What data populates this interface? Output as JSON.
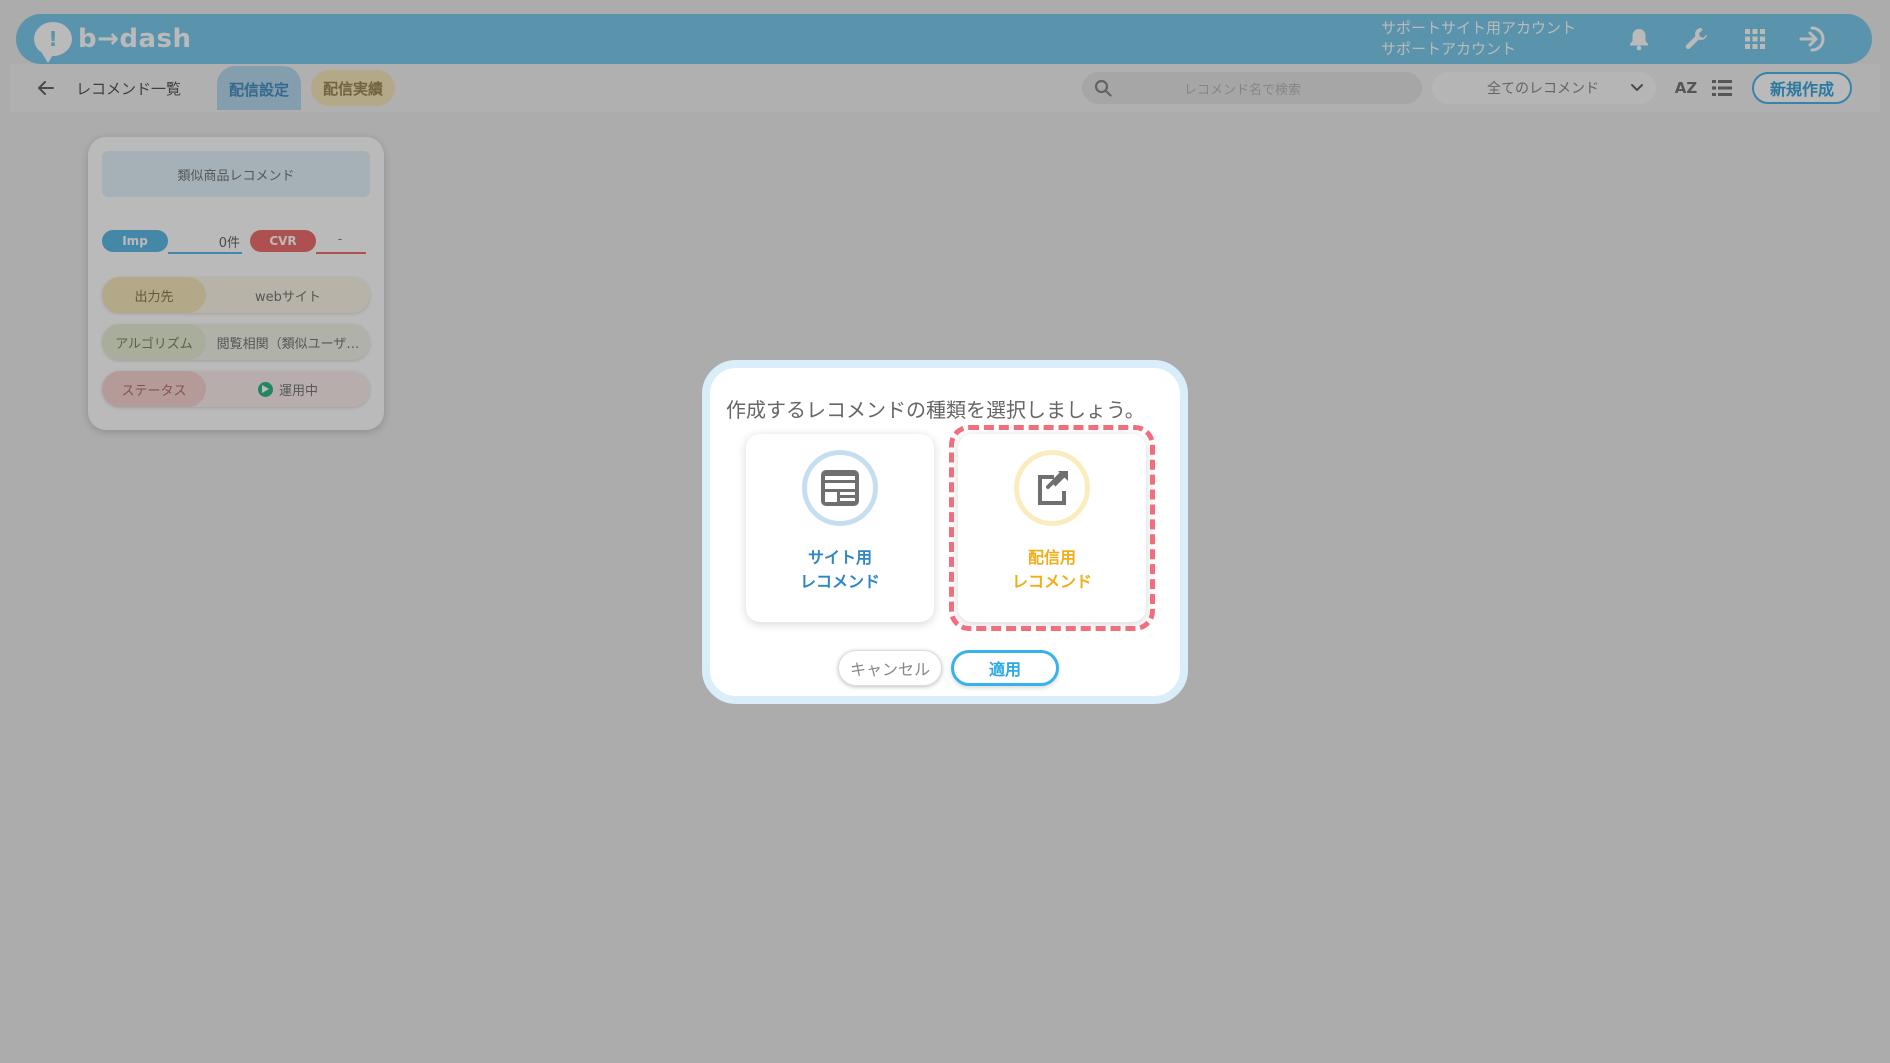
{
  "header": {
    "logo_text": "b→dash",
    "account_line1": "サポートサイト用アカウント",
    "account_line2": "サポートアカウント",
    "icons": [
      "bell-icon",
      "wrench-icon",
      "grid-icon",
      "logout-icon"
    ]
  },
  "subbar": {
    "back_label": "レコメンド一覧",
    "tabs": [
      {
        "label": "配信設定",
        "active": true
      },
      {
        "label": "配信実績",
        "active": false
      }
    ],
    "search_placeholder": "レコメンド名で検索",
    "filter_value": "全てのレコメンド",
    "sort_label": "AZ",
    "new_button": "新規作成"
  },
  "card": {
    "title": "類似商品レコメンド",
    "imp_label": "Imp",
    "imp_value": "0件",
    "cvr_label": "CVR",
    "cvr_value": "-",
    "rows": [
      {
        "label": "出力先",
        "value": "webサイト"
      },
      {
        "label": "アルゴリズム",
        "value": "閲覧相関（類似ユーザ…"
      },
      {
        "label": "ステータス",
        "value": "運用中"
      }
    ]
  },
  "modal": {
    "title": "作成するレコメンドの種類を選択しましょう。",
    "options": [
      {
        "line1": "サイト用",
        "line2": "レコメンド",
        "icon": "webpage-icon",
        "selected": false
      },
      {
        "line1": "配信用",
        "line2": "レコメンド",
        "icon": "external-share-icon",
        "selected": true
      }
    ],
    "cancel_label": "キャンセル",
    "apply_label": "適用"
  },
  "colors": {
    "brand": "#7ccbec",
    "site_blue": "#2f86c4",
    "delivery_yellow": "#f0ae1a",
    "highlight_red": "#ef6f7d"
  }
}
